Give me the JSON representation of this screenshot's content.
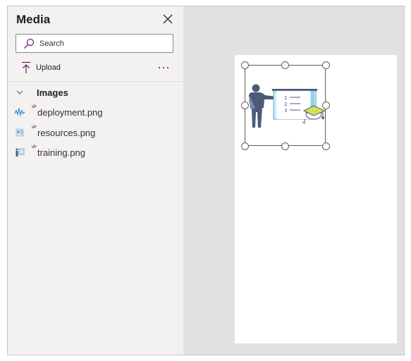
{
  "panel": {
    "title": "Media",
    "search_placeholder": "Search",
    "upload_label": "Upload",
    "more_label": "···",
    "group_label": "Images",
    "files": [
      {
        "name": "deployment.png",
        "thumb": "deployment-thumbnail"
      },
      {
        "name": "resources.png",
        "thumb": "resources-thumbnail"
      },
      {
        "name": "training.png",
        "thumb": "training-thumbnail"
      }
    ]
  },
  "colors": {
    "accent": "#742774",
    "panel_bg": "#f3f2f1",
    "canvas_bg": "#e1e1e1",
    "page_bg": "#ffffff"
  }
}
